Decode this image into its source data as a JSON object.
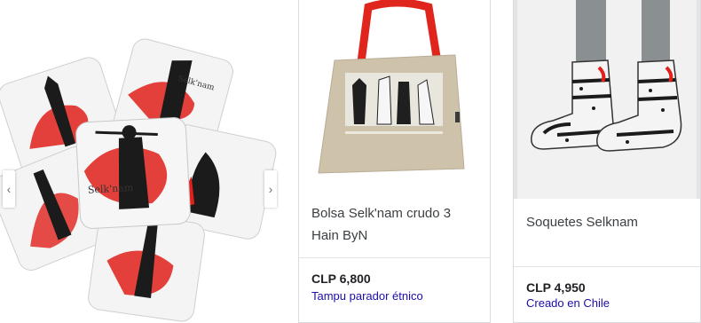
{
  "products": [
    {
      "image_alt": "Selk'nam coasters set",
      "title": "",
      "price": "",
      "store": ""
    },
    {
      "image_alt": "Selk'nam tote bag",
      "title": "Bolsa Selk'nam crudo 3 Hain ByN",
      "price": "CLP 6,800",
      "store": "Tampu parador étnico"
    },
    {
      "image_alt": "Selknam socks",
      "title": "Soquetes Selknam",
      "price": "CLP 4,950",
      "store": "Creado en Chile"
    }
  ],
  "carousel": {
    "prev_icon": "chevron-left-icon",
    "next_icon": "chevron-right-icon"
  },
  "coaster_brand": "Selk'nam",
  "colors": {
    "link": "#1a0dab",
    "accent_red": "#e0201a",
    "bag_beige": "#cfc2ab",
    "bag_handle": "#e0251c"
  }
}
